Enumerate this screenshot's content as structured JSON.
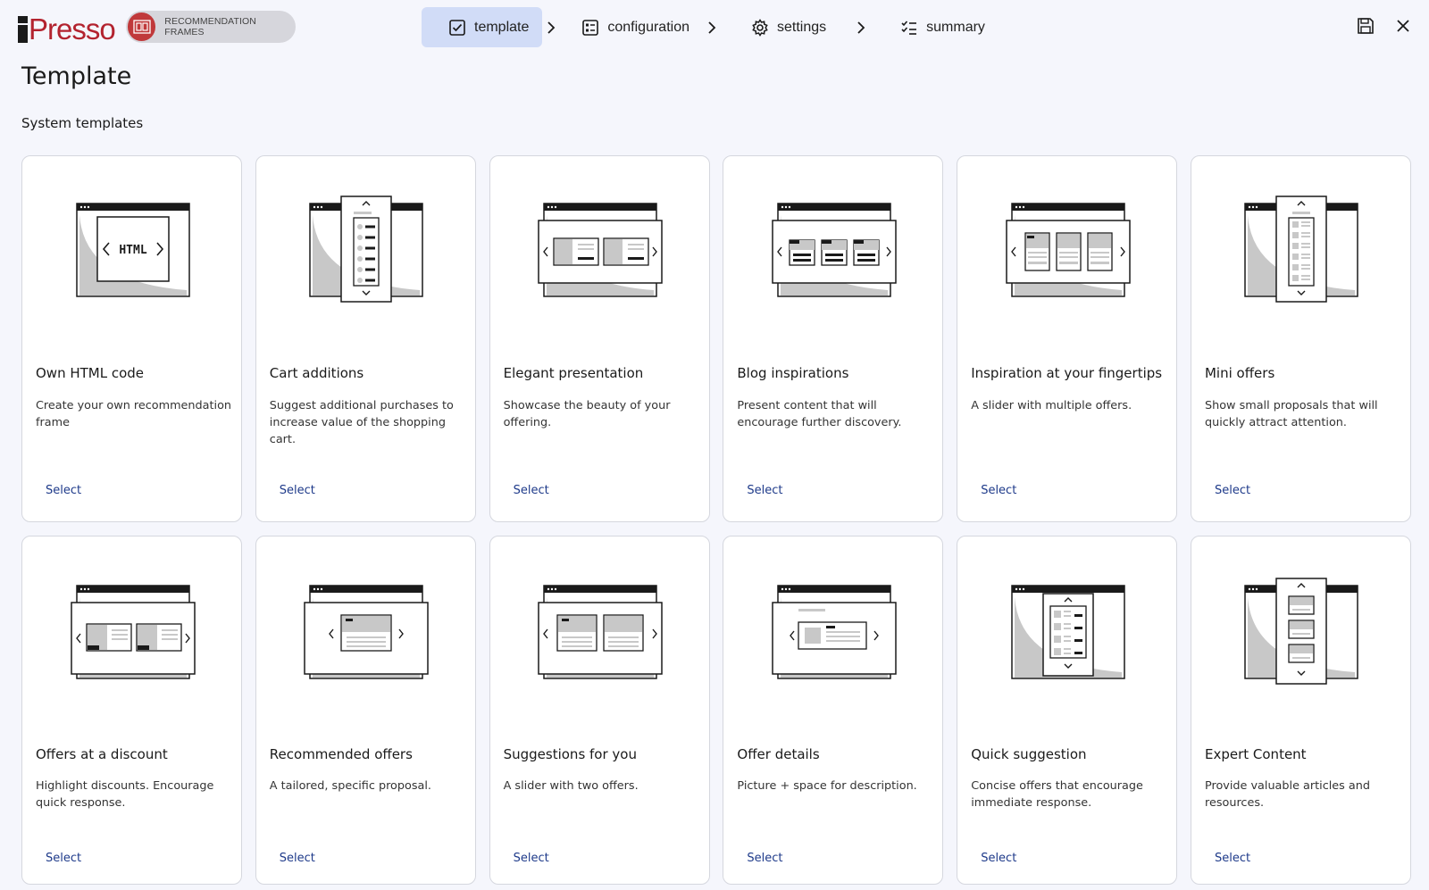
{
  "header": {
    "logo_text": "Presso",
    "module_label": "RECOMMENDATION FRAMES",
    "steps": [
      {
        "label": "template",
        "icon": "checkbox-icon",
        "active": true
      },
      {
        "label": "configuration",
        "icon": "list-icon",
        "active": false
      },
      {
        "label": "settings",
        "icon": "gear-icon",
        "active": false
      },
      {
        "label": "summary",
        "icon": "checklist-icon",
        "active": false
      }
    ],
    "actions": [
      "save-icon",
      "close-icon"
    ]
  },
  "page": {
    "title": "Template",
    "section_title": "System templates"
  },
  "colors": {
    "background": "#f5f6fc",
    "active_step": "#d1dcf7",
    "brand": "#b3232f",
    "link": "#1e3a8a"
  },
  "templates": [
    {
      "title": "Own HTML code",
      "description": "Create your own recommendation frame",
      "action": "Select",
      "html_label": "HTML"
    },
    {
      "title": "Cart additions",
      "description": "Suggest additional purchases to increase value of the shopping cart.",
      "action": "Select"
    },
    {
      "title": "Elegant presentation",
      "description": "Showcase the beauty of your offering.",
      "action": "Select"
    },
    {
      "title": "Blog inspirations",
      "description": "Present content that will encourage further discovery.",
      "action": "Select"
    },
    {
      "title": "Inspiration at your fingertips",
      "description": "A slider with multiple offers.",
      "action": "Select"
    },
    {
      "title": "Mini offers",
      "description": "Show small proposals that will quickly attract attention.",
      "action": "Select"
    },
    {
      "title": "Offers at a discount",
      "description": "Highlight discounts. Encourage quick response.",
      "action": "Select"
    },
    {
      "title": "Recommended offers",
      "description": "A tailored, specific proposal.",
      "action": "Select"
    },
    {
      "title": "Suggestions for you",
      "description": "A slider with two offers.",
      "action": "Select"
    },
    {
      "title": "Offer details",
      "description": "Picture + space for description.",
      "action": "Select"
    },
    {
      "title": "Quick suggestion",
      "description": "Concise offers that encourage immediate response.",
      "action": "Select"
    },
    {
      "title": "Expert Content",
      "description": "Provide valuable articles and resources.",
      "action": "Select"
    }
  ]
}
